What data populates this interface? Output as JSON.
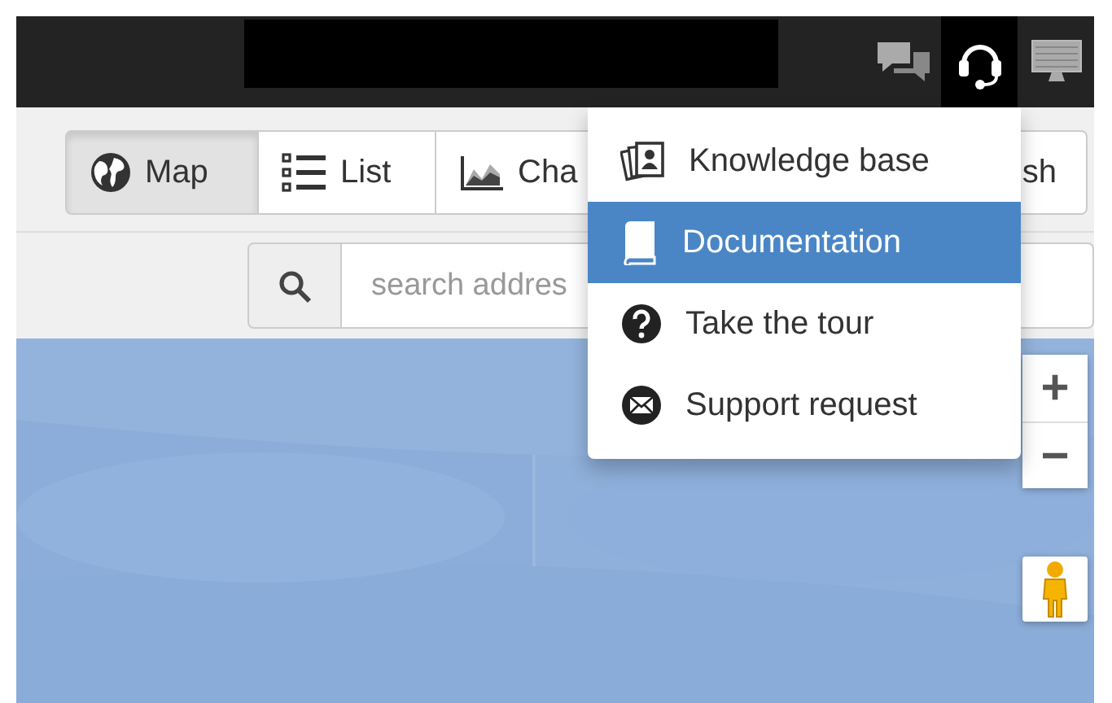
{
  "top_bar": {
    "icons": [
      {
        "kind": "chat",
        "selected": false
      },
      {
        "kind": "headset",
        "selected": true
      },
      {
        "kind": "monitor",
        "selected": false
      }
    ]
  },
  "view_buttons": [
    {
      "label": "Map",
      "selected": true
    },
    {
      "label": "List",
      "selected": false
    },
    {
      "label": "Cha",
      "selected": false
    },
    {
      "label": "sh",
      "selected": false
    }
  ],
  "search": {
    "placeholder": "search addres"
  },
  "map_controls": {
    "zoom_in": "+",
    "zoom_out": "−"
  },
  "help_menu": {
    "items": [
      {
        "label": "Knowledge base",
        "selected": false
      },
      {
        "label": "Documentation",
        "selected": true
      },
      {
        "label": "Take the tour",
        "selected": false
      },
      {
        "label": "Support request",
        "selected": false
      }
    ]
  }
}
